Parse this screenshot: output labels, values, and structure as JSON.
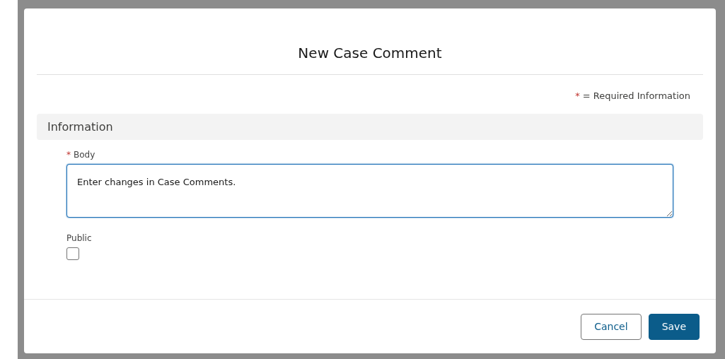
{
  "modal": {
    "title": "New Case Comment",
    "required_note": {
      "mark": "*",
      "text": "= Required Information"
    },
    "section": {
      "title": "Information"
    },
    "fields": [
      {
        "kind": "textarea",
        "label": "Body",
        "required": true,
        "value": "Enter changes in Case Comments."
      },
      {
        "kind": "checkbox",
        "label": "Public",
        "required": false,
        "checked": false
      }
    ],
    "buttons": [
      {
        "label": "Cancel",
        "kind": "neutral"
      },
      {
        "label": "Save",
        "kind": "brand"
      }
    ]
  }
}
